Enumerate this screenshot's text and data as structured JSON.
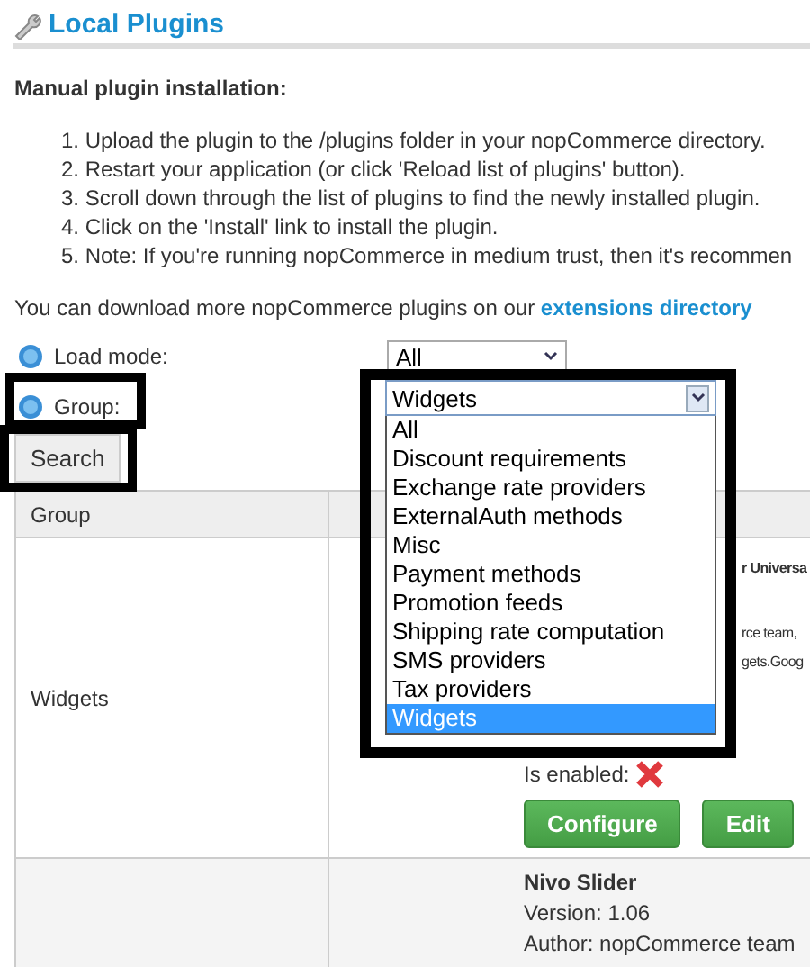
{
  "title": "Local Plugins",
  "instructions": {
    "heading": "Manual plugin installation:",
    "steps": [
      "1. Upload the plugin to the /plugins folder in your nopCommerce directory.",
      "2. Restart your application (or click 'Reload list of plugins' button).",
      "3. Scroll down through the list of plugins to find the newly installed plugin.",
      "4. Click on the 'Install' link to install the plugin.",
      "5. Note: If you're running nopCommerce in medium trust, then it's recommen"
    ]
  },
  "download_note": {
    "text": "You can download more nopCommerce plugins on our ",
    "link": "extensions directory"
  },
  "filters": [
    {
      "label": "Load mode:",
      "value": "All"
    },
    {
      "label": "Group:",
      "value": "Widgets",
      "highlighted": true
    }
  ],
  "search_button": {
    "label": "Search",
    "highlighted": true
  },
  "group_dropdown": {
    "highlighted": true,
    "options": [
      {
        "label": "All",
        "selected": false
      },
      {
        "label": "Discount requirements",
        "selected": false
      },
      {
        "label": "Exchange rate providers",
        "selected": false
      },
      {
        "label": "ExternalAuth methods",
        "selected": false
      },
      {
        "label": "Misc",
        "selected": false
      },
      {
        "label": "Payment methods",
        "selected": false
      },
      {
        "label": "Promotion feeds",
        "selected": false
      },
      {
        "label": "Shipping rate computation",
        "selected": false
      },
      {
        "label": "SMS providers",
        "selected": false
      },
      {
        "label": "Tax providers",
        "selected": false
      },
      {
        "label": "Widgets",
        "selected": true
      }
    ]
  },
  "table": {
    "columns": [
      "Group"
    ],
    "rows": [
      {
        "group": "Widgets",
        "fragments": [
          "r Universa",
          "rce team,",
          "gets.Goog"
        ],
        "enabled_label": "Is enabled:",
        "enabled": false,
        "buttons": [
          "Configure",
          "Edit"
        ]
      },
      {
        "name": "Nivo Slider",
        "version": "Version: 1.06",
        "author": "Author: nopCommerce team"
      }
    ]
  }
}
